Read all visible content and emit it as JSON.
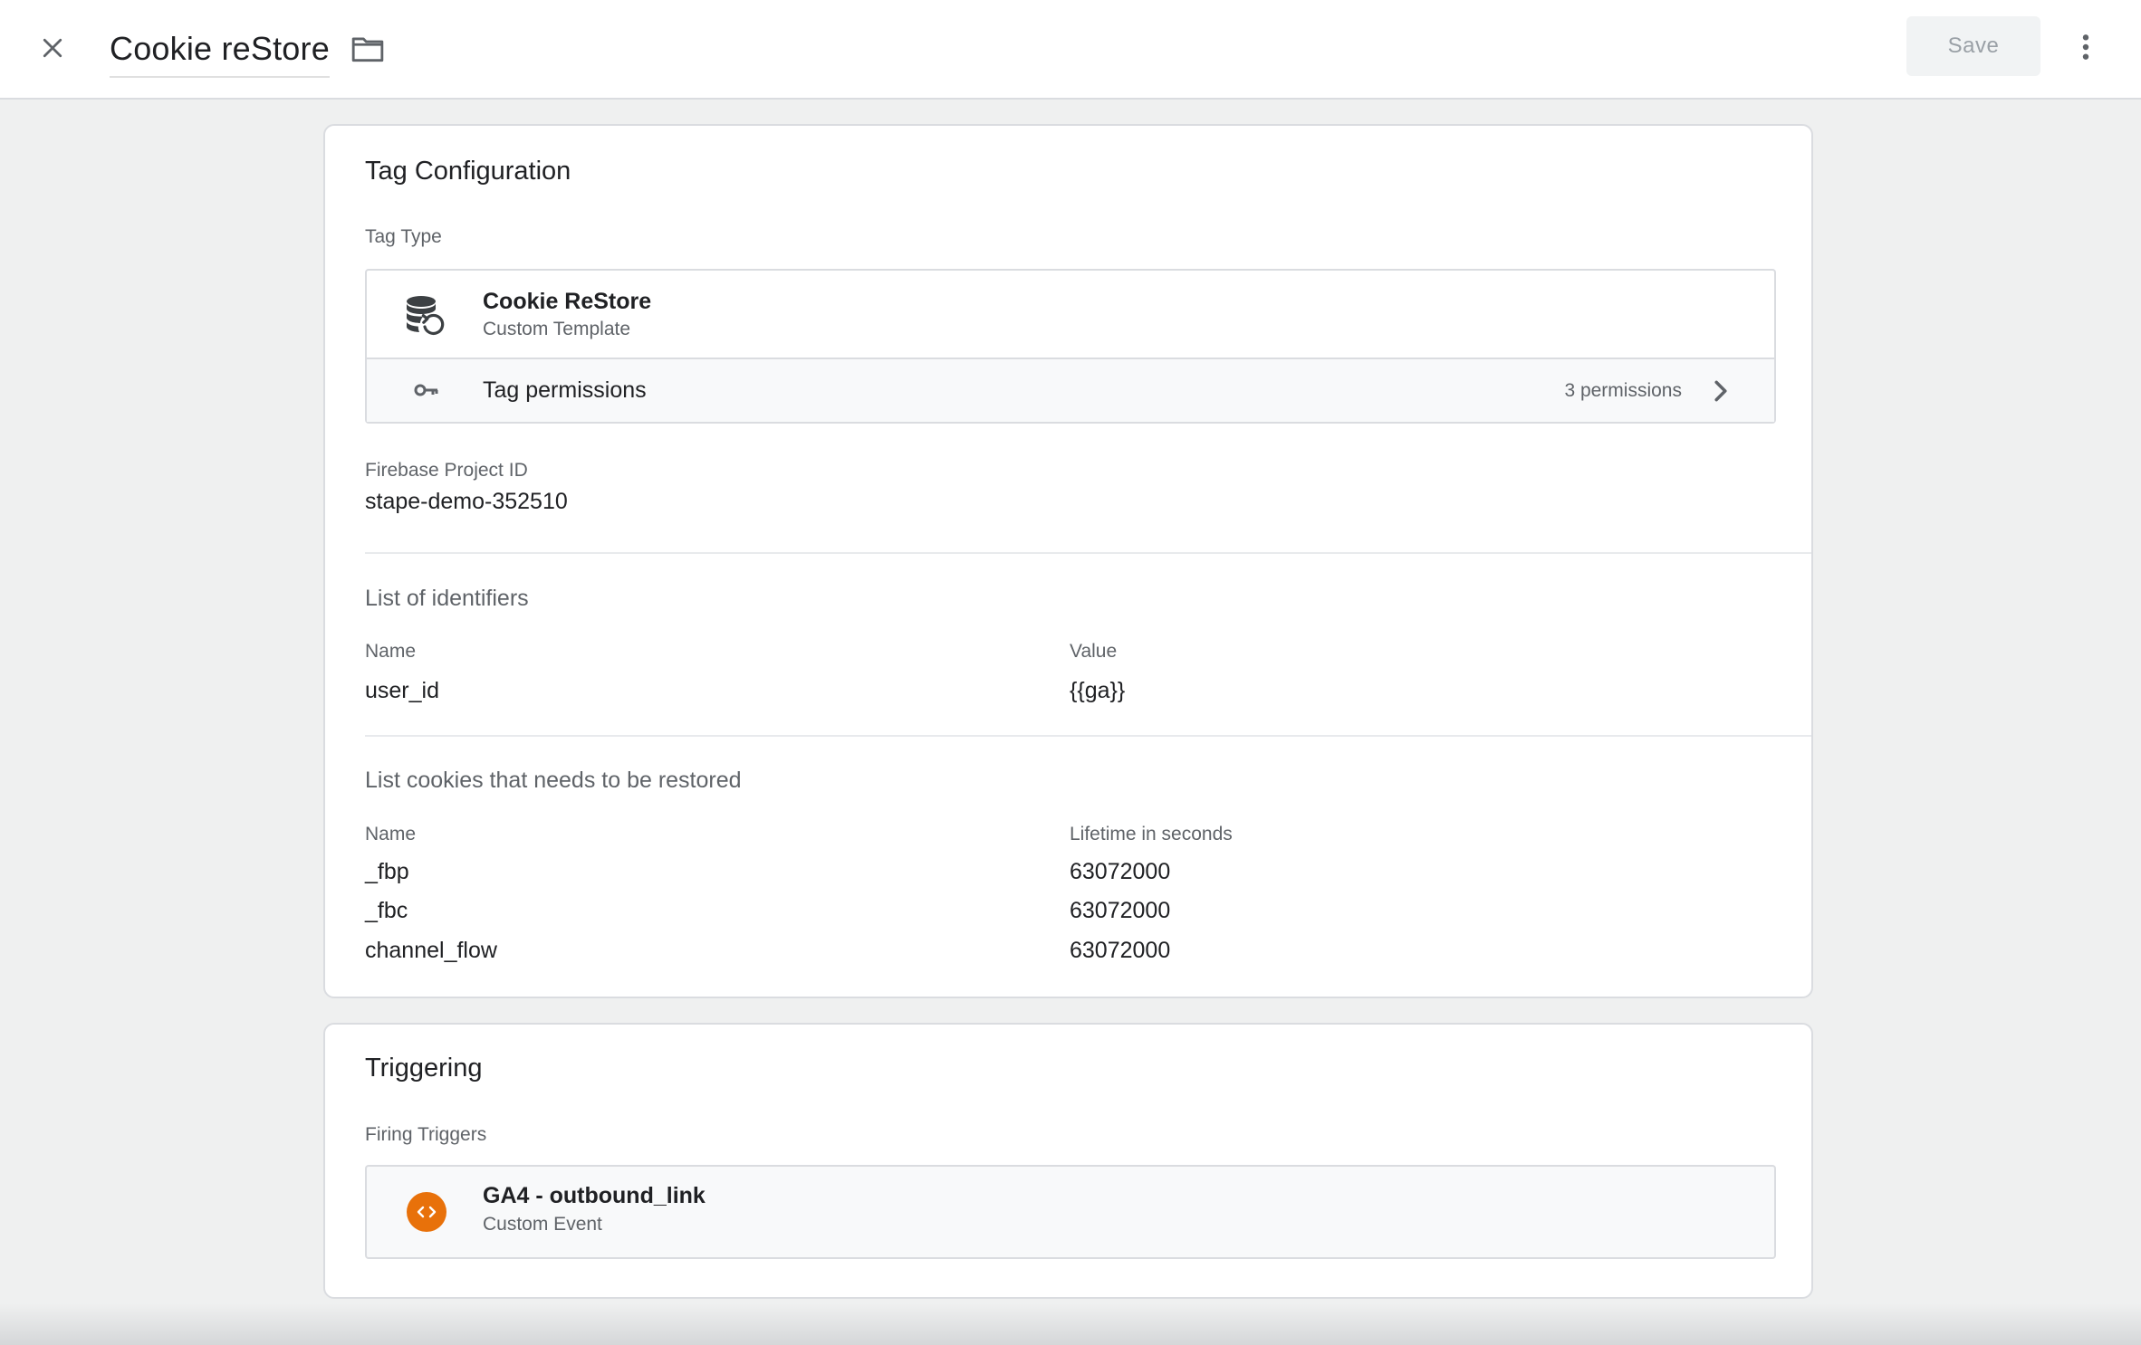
{
  "header": {
    "title": "Cookie reStore",
    "save_label": "Save"
  },
  "icons": {
    "close": "close-icon",
    "folder": "folder-icon",
    "more": "more-vert-icon",
    "tag_type": "database-restore-icon",
    "permissions": "key-icon",
    "chevron": "chevron-right-icon",
    "trigger": "custom-event-icon"
  },
  "colors": {
    "trigger_accent": "#e8710a",
    "save_disabled_bg": "#f1f3f4"
  },
  "tag_config": {
    "title": "Tag Configuration",
    "tag_type_label": "Tag Type",
    "tag_type": {
      "name": "Cookie ReStore",
      "subtitle": "Custom Template"
    },
    "permissions": {
      "label": "Tag permissions",
      "count": "3 permissions"
    },
    "firebase": {
      "label": "Firebase Project ID",
      "value": "stape-demo-352510"
    },
    "identifiers": {
      "heading": "List of identifiers",
      "col_name": "Name",
      "col_value": "Value",
      "rows": [
        {
          "name": "user_id",
          "value": "{{ga}}"
        }
      ]
    },
    "cookies": {
      "heading": "List cookies that needs to be restored",
      "col_name": "Name",
      "col_lifetime": "Lifetime in seconds",
      "rows": [
        {
          "name": "_fbp",
          "lifetime": "63072000"
        },
        {
          "name": "_fbc",
          "lifetime": "63072000"
        },
        {
          "name": "channel_flow",
          "lifetime": "63072000"
        }
      ]
    }
  },
  "triggering": {
    "title": "Triggering",
    "firing_label": "Firing Triggers",
    "trigger": {
      "name": "GA4 - outbound_link",
      "type": "Custom Event"
    }
  }
}
